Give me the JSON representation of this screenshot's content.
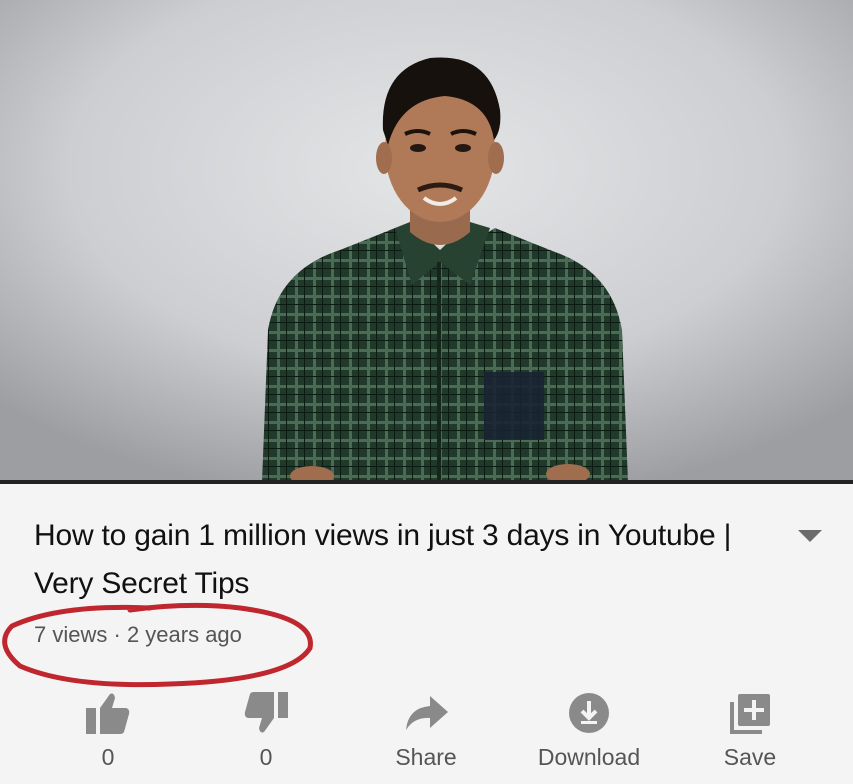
{
  "video": {
    "title": "How to gain 1 million views in just 3 days in Youtube | Very Secret Tips",
    "views": "7 views",
    "separator": "·",
    "age": "2 years ago"
  },
  "actions": {
    "like_count": "0",
    "dislike_count": "0",
    "share_label": "Share",
    "download_label": "Download",
    "save_label": "Save"
  },
  "colors": {
    "text": "#111111",
    "meta": "#555555",
    "icon": "#8a8a8a",
    "annotation": "#c0262d",
    "background": "#f4f4f4"
  },
  "icons": [
    "thumbs-up-icon",
    "thumbs-down-icon",
    "share-icon",
    "download-icon",
    "add-to-playlist-icon",
    "chevron-down-icon"
  ]
}
